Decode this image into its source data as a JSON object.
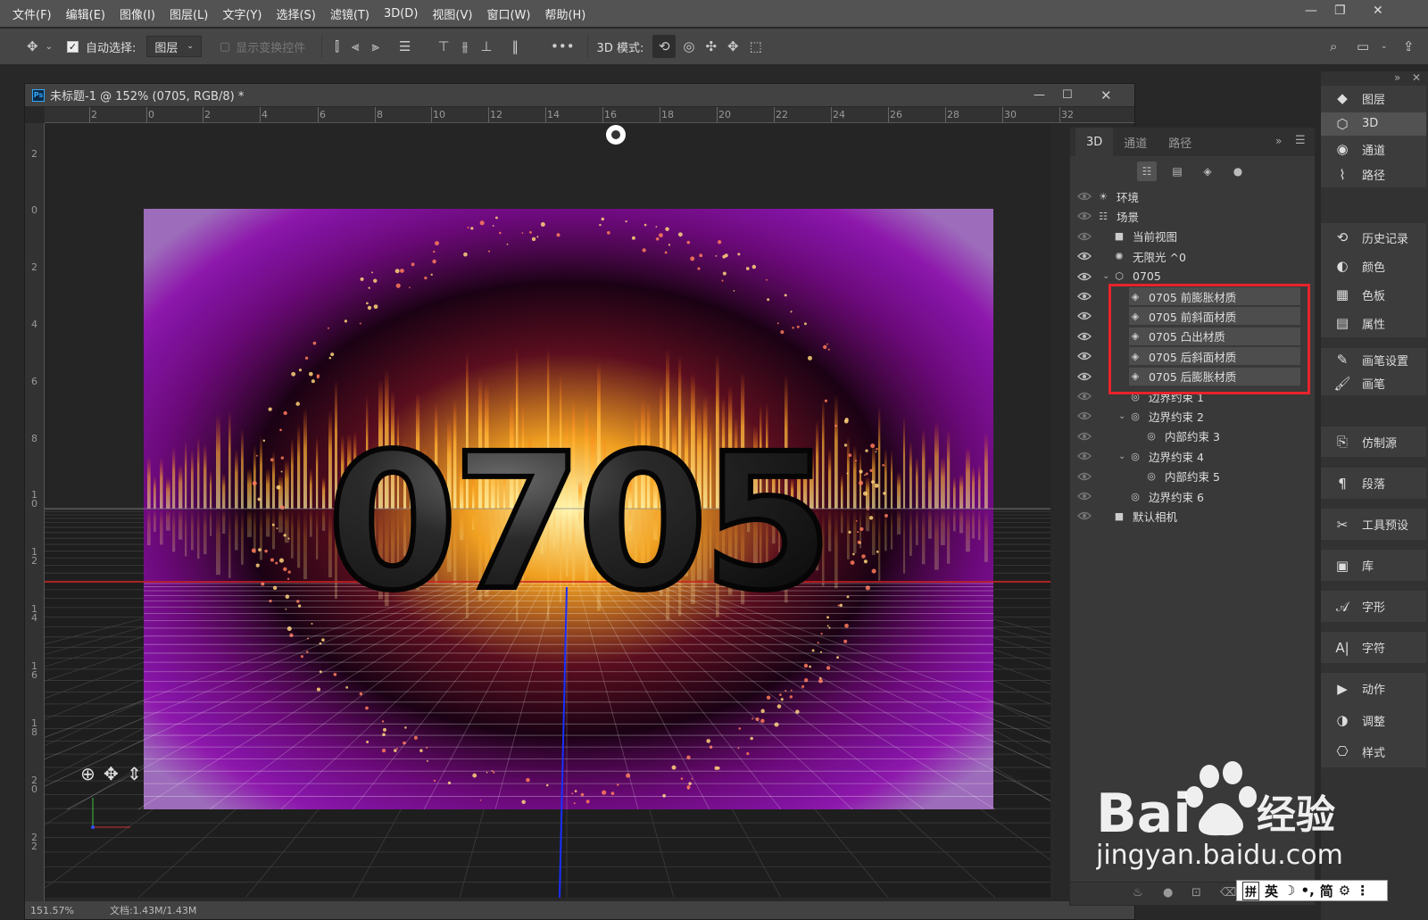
{
  "menu": [
    "文件(F)",
    "编辑(E)",
    "图像(I)",
    "图层(L)",
    "文字(Y)",
    "选择(S)",
    "滤镜(T)",
    "3D(D)",
    "视图(V)",
    "窗口(W)",
    "帮助(H)"
  ],
  "options": {
    "auto_select_label": "自动选择:",
    "auto_select_checked": true,
    "layer_select": "图层",
    "show_transform": "显示变换控件",
    "mode_label": "3D 模式:"
  },
  "document": {
    "title": "未标题-1 @ 152% (0705, RGB/8) *",
    "h_ruler": [
      "2",
      "0",
      "2",
      "4",
      "6",
      "8",
      "10",
      "12",
      "14",
      "16",
      "18",
      "20",
      "22",
      "24",
      "26",
      "28",
      "30",
      "32"
    ],
    "v_ruler": [
      "2",
      "0",
      "2",
      "4",
      "6",
      "8",
      "1\n0",
      "1\n2",
      "1\n4",
      "1\n6",
      "1\n8",
      "2\n0",
      "2\n2"
    ],
    "canvas_text": "0705",
    "status_zoom": "151.57%",
    "status_doc": "文档:1.43M/1.43M"
  },
  "panel3d": {
    "tabs": [
      "3D",
      "通道",
      "路径"
    ],
    "active_tab": "3D",
    "tree": [
      {
        "label": "环境",
        "icon": "environment-icon",
        "visible": false,
        "indent": 0
      },
      {
        "label": "场景",
        "icon": "scene-icon",
        "visible": false,
        "indent": 0
      },
      {
        "label": "当前视图",
        "icon": "camera-icon",
        "visible": false,
        "indent": 1
      },
      {
        "label": "无限光 ^0",
        "icon": "light-icon",
        "visible": true,
        "indent": 1
      },
      {
        "label": "0705",
        "icon": "mesh-icon",
        "visible": true,
        "indent": 1,
        "expanded": true
      },
      {
        "label": "0705 前膨胀材质",
        "icon": "material-icon",
        "visible": true,
        "indent": 2,
        "material": true
      },
      {
        "label": "0705 前斜面材质",
        "icon": "material-icon",
        "visible": true,
        "indent": 2,
        "material": true
      },
      {
        "label": "0705 凸出材质",
        "icon": "material-icon",
        "visible": true,
        "indent": 2,
        "material": true
      },
      {
        "label": "0705 后斜面材质",
        "icon": "material-icon",
        "visible": true,
        "indent": 2,
        "material": true
      },
      {
        "label": "0705 后膨胀材质",
        "icon": "material-icon",
        "visible": true,
        "indent": 2,
        "material": true
      },
      {
        "label": "边界约束 1",
        "icon": "constraint-icon",
        "visible": false,
        "indent": 2
      },
      {
        "label": "边界约束 2",
        "icon": "constraint-icon",
        "visible": false,
        "indent": 2,
        "expanded": true
      },
      {
        "label": "内部约束 3",
        "icon": "constraint-icon",
        "visible": false,
        "indent": 3
      },
      {
        "label": "边界约束 4",
        "icon": "constraint-icon",
        "visible": false,
        "indent": 2,
        "expanded": true
      },
      {
        "label": "内部约束 5",
        "icon": "constraint-icon",
        "visible": false,
        "indent": 3
      },
      {
        "label": "边界约束 6",
        "icon": "constraint-icon",
        "visible": false,
        "indent": 2
      },
      {
        "label": "默认相机",
        "icon": "camera-icon",
        "visible": false,
        "indent": 1
      }
    ]
  },
  "dock": {
    "groups": [
      [
        "图层",
        "3D",
        "通道",
        "路径"
      ],
      [
        "历史记录",
        "颜色",
        "色板",
        "属性"
      ],
      [
        "画笔设置",
        "画笔"
      ],
      [
        "仿制源"
      ],
      [
        "段落"
      ],
      [
        "工具预设"
      ],
      [
        "库"
      ],
      [
        "字形"
      ],
      [
        "字符"
      ],
      [
        "动作",
        "调整",
        "样式"
      ]
    ],
    "icons": [
      [
        "layers-icon",
        "cube-icon",
        "channels-icon",
        "paths-icon"
      ],
      [
        "history-icon",
        "color-icon",
        "swatches-icon",
        "properties-icon"
      ],
      [
        "brush-settings-icon",
        "brush-icon"
      ],
      [
        "clone-source-icon"
      ],
      [
        "paragraph-icon"
      ],
      [
        "tool-presets-icon"
      ],
      [
        "libraries-icon"
      ],
      [
        "glyphs-icon"
      ],
      [
        "character-icon"
      ],
      [
        "actions-icon",
        "adjustments-icon",
        "styles-icon"
      ]
    ],
    "active": "3D"
  },
  "watermark": {
    "brand": "Bai",
    "brand2": "经验",
    "url": "jingyan.baidu.com"
  },
  "ime": [
    "拼",
    "英",
    "简"
  ]
}
